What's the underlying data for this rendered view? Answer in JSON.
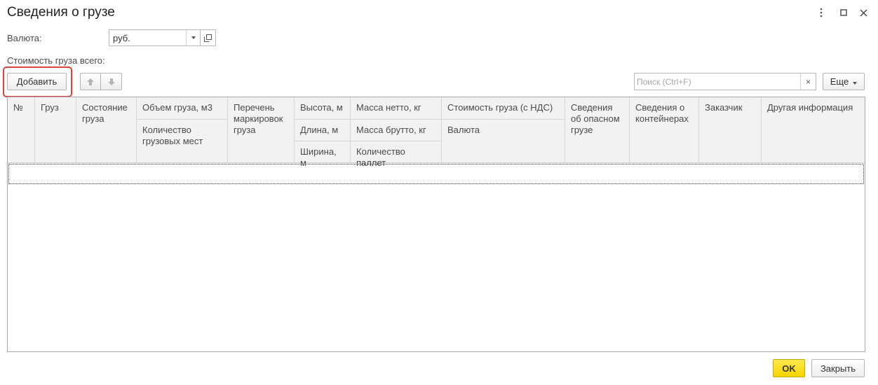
{
  "window": {
    "title": "Сведения о грузе",
    "more_icon": "more-vertical-icon",
    "maximize_icon": "maximize-icon",
    "close_icon": "close-icon"
  },
  "currency": {
    "label": "Валюта:",
    "value": "руб."
  },
  "total_cost_label": "Стоимость груза всего:",
  "toolbar": {
    "add_label": "Добавить",
    "move_up_icon": "arrow-up-icon",
    "move_down_icon": "arrow-down-icon",
    "search_placeholder": "Поиск (Ctrl+F)",
    "search_clear": "×",
    "more_label": "Еще"
  },
  "table": {
    "columns": [
      {
        "rows": [
          "№"
        ]
      },
      {
        "rows": [
          "Груз"
        ]
      },
      {
        "rows": [
          "Состояние груза"
        ]
      },
      {
        "rows": [
          "Объем груза, м3",
          "Количество грузовых мест"
        ]
      },
      {
        "rows": [
          "Перечень маркировок груза"
        ]
      },
      {
        "rows": [
          "Высота, м",
          "Длина, м",
          "Ширина, м"
        ]
      },
      {
        "rows": [
          "Масса нетто, кг",
          "Масса брутто, кг",
          "Количество паллет"
        ]
      },
      {
        "rows": [
          "Стоимость груза (с НДС)",
          "Валюта"
        ]
      },
      {
        "rows": [
          "Сведения об опасном грузе"
        ]
      },
      {
        "rows": [
          "Сведения о контейнерах"
        ]
      },
      {
        "rows": [
          "Заказчик"
        ]
      },
      {
        "rows": [
          "Другая информация"
        ]
      }
    ]
  },
  "footer": {
    "ok_label": "OK",
    "close_label": "Закрыть"
  },
  "colors": {
    "highlight": "#e0433b",
    "ok_button": "#f5d400"
  }
}
